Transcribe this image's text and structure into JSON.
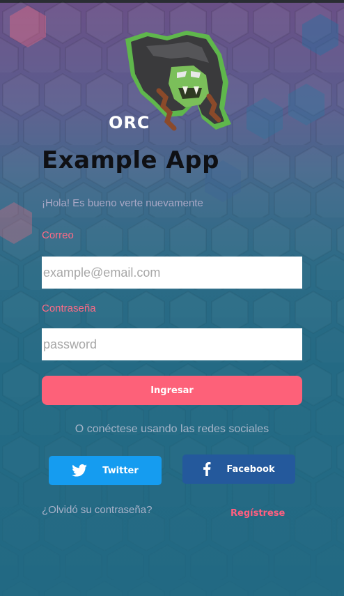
{
  "app": {
    "logo_text": "ORC",
    "title": "Example App",
    "greeting": "¡Hola! Es bueno verte nuevamente"
  },
  "form": {
    "email_label": "Correo",
    "email_placeholder": "example@email.com",
    "email_value": "",
    "password_label": "Contraseña",
    "password_placeholder": "password",
    "password_value": "",
    "login_label": "Ingresar"
  },
  "social": {
    "prompt": "O conéctese usando las redes sociales",
    "twitter_label": "Twitter",
    "twitter_icon": "twitter-bird-icon",
    "facebook_label": "Facebook",
    "facebook_icon": "facebook-f-icon"
  },
  "footer": {
    "forgot_label": "¿Olvidó su contraseña?",
    "register_label": "Regístrese"
  },
  "colors": {
    "accent": "#fd6179",
    "twitter": "#159cf0",
    "facebook": "#24599c",
    "background": "#246a84"
  }
}
